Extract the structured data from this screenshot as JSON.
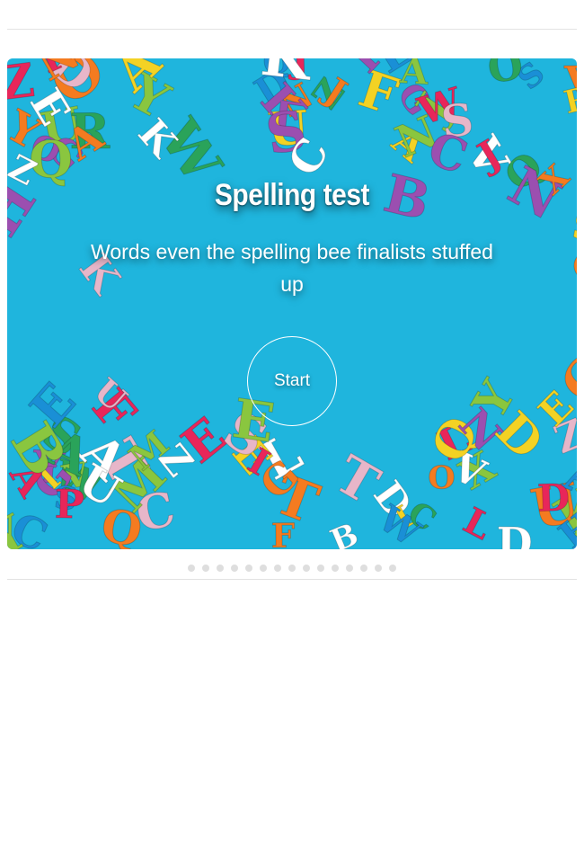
{
  "quiz": {
    "title": "Spelling test",
    "subtitle": "Words even the spelling bee finalists stuffed up",
    "start_label": "Start",
    "background_color": "#1fb5dd"
  },
  "pagination": {
    "count": 15,
    "active_index": 0,
    "dot_color": "#dedede"
  },
  "hero_image": {
    "description_icon": "wooden-alphabet-letters-image",
    "letter_colors": [
      "#e8265a",
      "#f3d224",
      "#8ac63f",
      "#f47b20",
      "#9b4fb0",
      "#ffffff",
      "#1a8fd6",
      "#e7b6c9",
      "#2aa35a"
    ]
  }
}
